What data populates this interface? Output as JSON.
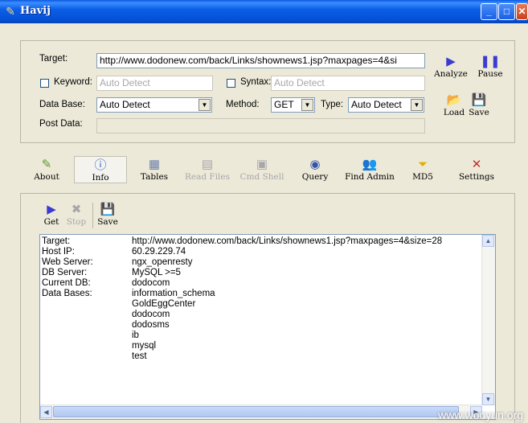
{
  "window": {
    "title": "Havij",
    "minimize": "_",
    "maximize": "□",
    "close": "✕"
  },
  "target_panel": {
    "target_label": "Target:",
    "target_value": "http://www.dodonew.com/back/Links/shownews1.jsp?maxpages=4&si",
    "keyword_label": "Keyword:",
    "keyword_placeholder": "Auto Detect",
    "syntax_label": "Syntax:",
    "syntax_placeholder": "Auto Detect",
    "database_label": "Data Base:",
    "database_value": "Auto Detect",
    "method_label": "Method:",
    "method_value": "GET",
    "type_label": "Type:",
    "type_value": "Auto Detect",
    "postdata_label": "Post Data:",
    "analyze": "Analyze",
    "pause": "Pause",
    "load": "Load",
    "save": "Save"
  },
  "main_toolbar": {
    "about": "About",
    "info": "Info",
    "tables": "Tables",
    "read_files": "Read Files",
    "cmd_shell": "Cmd Shell",
    "query": "Query",
    "find_admin": "Find Admin",
    "md5": "MD5",
    "settings": "Settings"
  },
  "info_toolbar": {
    "get": "Get",
    "stop": "Stop",
    "save": "Save"
  },
  "results": [
    {
      "key": "Target:",
      "value": "http://www.dodonew.com/back/Links/shownews1.jsp?maxpages=4&size=28"
    },
    {
      "key": "Host IP:",
      "value": "60.29.229.74"
    },
    {
      "key": "Web Server:",
      "value": "ngx_openresty"
    },
    {
      "key": "DB Server:",
      "value": "MySQL >=5"
    },
    {
      "key": "Current DB:",
      "value": "dodocom"
    },
    {
      "key": "Data Bases:",
      "value": "information_schema"
    },
    {
      "key": "",
      "value": "GoldEggCenter"
    },
    {
      "key": "",
      "value": "dodocom"
    },
    {
      "key": "",
      "value": "dodosms"
    },
    {
      "key": "",
      "value": "ib"
    },
    {
      "key": "",
      "value": "mysql"
    },
    {
      "key": "",
      "value": "test"
    }
  ],
  "watermark": "www.wooyun.org"
}
